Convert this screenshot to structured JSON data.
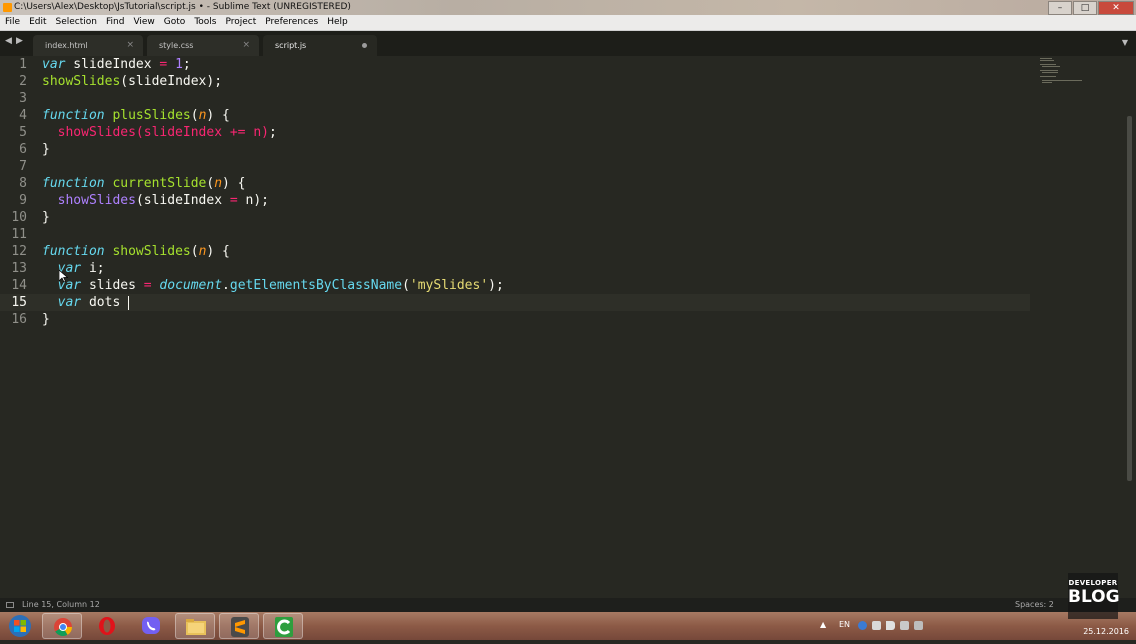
{
  "window": {
    "title": "C:\\Users\\Alex\\Desktop\\JsTutorial\\script.js • - Sublime Text (UNREGISTERED)"
  },
  "menu": [
    "File",
    "Edit",
    "Selection",
    "Find",
    "View",
    "Goto",
    "Tools",
    "Project",
    "Preferences",
    "Help"
  ],
  "tabs": [
    {
      "label": "index.html",
      "active": false,
      "dirty": false
    },
    {
      "label": "style.css",
      "active": false,
      "dirty": false
    },
    {
      "label": "script.js",
      "active": true,
      "dirty": true
    }
  ],
  "editor": {
    "line_numbers": [
      "1",
      "2",
      "3",
      "4",
      "5",
      "6",
      "7",
      "8",
      "9",
      "10",
      "11",
      "12",
      "13",
      "14",
      "15",
      "16"
    ],
    "current_line": 15
  },
  "status": {
    "position": "Line 15, Column 12",
    "spaces": "Spaces: 2"
  },
  "taskbar": {
    "apps": [
      "windows-start",
      "chrome",
      "opera",
      "viber",
      "file-explorer",
      "sublime-text",
      "camtasia"
    ],
    "language": "EN",
    "date": "25.12.2016"
  },
  "watermark": {
    "line1": "DEVELOPER",
    "line2": "BLOG"
  },
  "colors": {
    "background": "#272822",
    "keyword": "#66d9ef",
    "function": "#a6e22e",
    "param": "#fd971f",
    "number": "#ae81ff",
    "operator": "#f92672",
    "string": "#e6db74"
  }
}
